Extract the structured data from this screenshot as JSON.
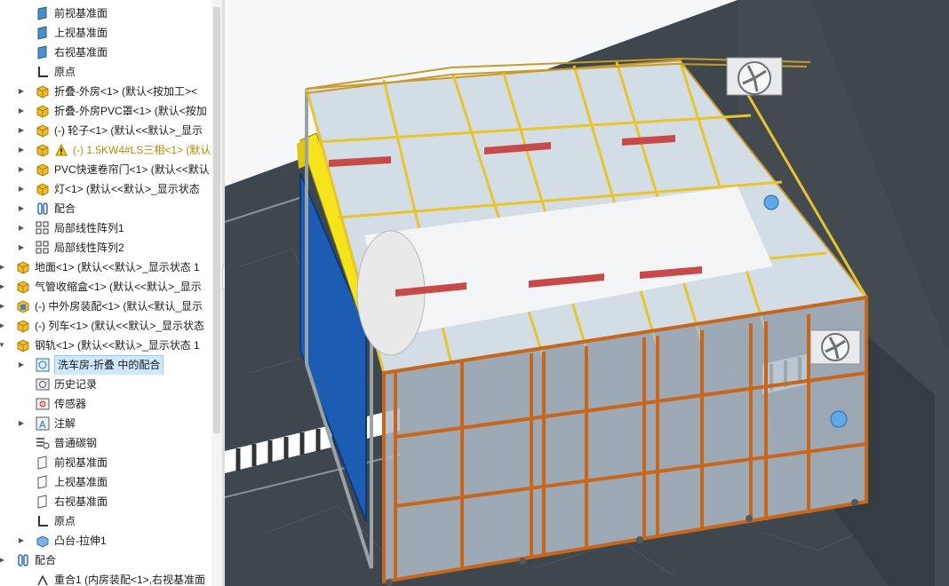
{
  "feature_tree": {
    "items": [
      {
        "label": "前视基准面",
        "icon": "plane-icon",
        "expandable": false,
        "warning": false
      },
      {
        "label": "上视基准面",
        "icon": "plane-icon",
        "expandable": false,
        "warning": false
      },
      {
        "label": "右视基准面",
        "icon": "plane-icon",
        "expandable": false,
        "warning": false
      },
      {
        "label": "原点",
        "icon": "origin-icon",
        "expandable": false,
        "warning": false
      },
      {
        "label": "折叠-外房<1> (默认<按加工><",
        "icon": "component-icon",
        "expandable": true,
        "warning": false
      },
      {
        "label": "折叠-外房PVC罩<1> (默认<按加",
        "icon": "component-icon",
        "expandable": true,
        "warning": false
      },
      {
        "label": "(-) 轮子<1> (默认<<默认>_显示",
        "icon": "component-icon",
        "expandable": true,
        "warning": false
      },
      {
        "label": "(-) 1.5KW4#LS三相<1> (默认",
        "icon": "component-icon",
        "expandable": true,
        "warning": true
      },
      {
        "label": "PVC快速卷帘门<1> (默认<<默认",
        "icon": "component-icon",
        "expandable": true,
        "warning": false
      },
      {
        "label": "灯<1> (默认<<默认>_显示状态",
        "icon": "component-icon",
        "expandable": true,
        "warning": false
      },
      {
        "label": "配合",
        "icon": "mates-icon",
        "expandable": true,
        "warning": false
      },
      {
        "label": "局部线性阵列1",
        "icon": "pattern-icon",
        "expandable": true,
        "warning": false
      },
      {
        "label": "局部线性阵列2",
        "icon": "pattern-icon",
        "expandable": true,
        "warning": false
      },
      {
        "label": "地面<1> (默认<<默认>_显示状态 1",
        "icon": "component-icon",
        "expandable": true,
        "warning": false
      },
      {
        "label": "气管收缩盒<1> (默认<<默认>_显示",
        "icon": "component-icon",
        "expandable": true,
        "warning": false
      },
      {
        "label": "(-) 中外房装配<1> (默认<默认_显示",
        "icon": "subassembly-icon",
        "expandable": true,
        "warning": false
      },
      {
        "label": "(-) 列车<1> (默认<<默认>_显示状态",
        "icon": "component-icon",
        "expandable": true,
        "warning": false
      },
      {
        "label": "钢轨<1> (默认<<默认>_显示状态 1",
        "icon": "component-icon",
        "expandable": true,
        "expanded": true,
        "warning": false
      },
      {
        "label": "洗车房-折叠 中的配合",
        "icon": "mates-in-assembly-icon",
        "expandable": true,
        "warning": false,
        "selected": true
      },
      {
        "label": "历史记录",
        "icon": "history-icon",
        "expandable": false,
        "warning": false
      },
      {
        "label": "传感器",
        "icon": "sensor-icon",
        "expandable": false,
        "warning": false
      },
      {
        "label": "注解",
        "icon": "annotation-icon",
        "expandable": true,
        "warning": false
      },
      {
        "label": "普通碳钢",
        "icon": "material-icon",
        "expandable": false,
        "warning": false
      },
      {
        "label": "前视基准面",
        "icon": "plane-outline-icon",
        "expandable": false,
        "warning": false
      },
      {
        "label": "上视基准面",
        "icon": "plane-outline-icon",
        "expandable": false,
        "warning": false
      },
      {
        "label": "右视基准面",
        "icon": "plane-outline-icon",
        "expandable": false,
        "warning": false
      },
      {
        "label": "原点",
        "icon": "origin-icon",
        "expandable": false,
        "warning": false
      },
      {
        "label": "凸台-拉伸1",
        "icon": "extrude-icon",
        "expandable": true,
        "warning": false
      },
      {
        "label": "配合",
        "icon": "mates-icon",
        "expandable": true,
        "warning": false
      },
      {
        "label": "重合1 (内房装配<1>,右视基准面",
        "icon": "coincident-icon",
        "expandable": false,
        "warning": false
      }
    ]
  },
  "viewport": {
    "colors": {
      "floor": "#3c444b",
      "wall": "#40464b",
      "frame_orange": "#c8661c",
      "frame_yellow": "#f2cc2a",
      "glass": "#b7c6d2",
      "door_blue": "#1f5fb4",
      "door_yellow": "#f3e21a",
      "rail_white": "#ffffff",
      "selection": "#cde8ff"
    }
  }
}
